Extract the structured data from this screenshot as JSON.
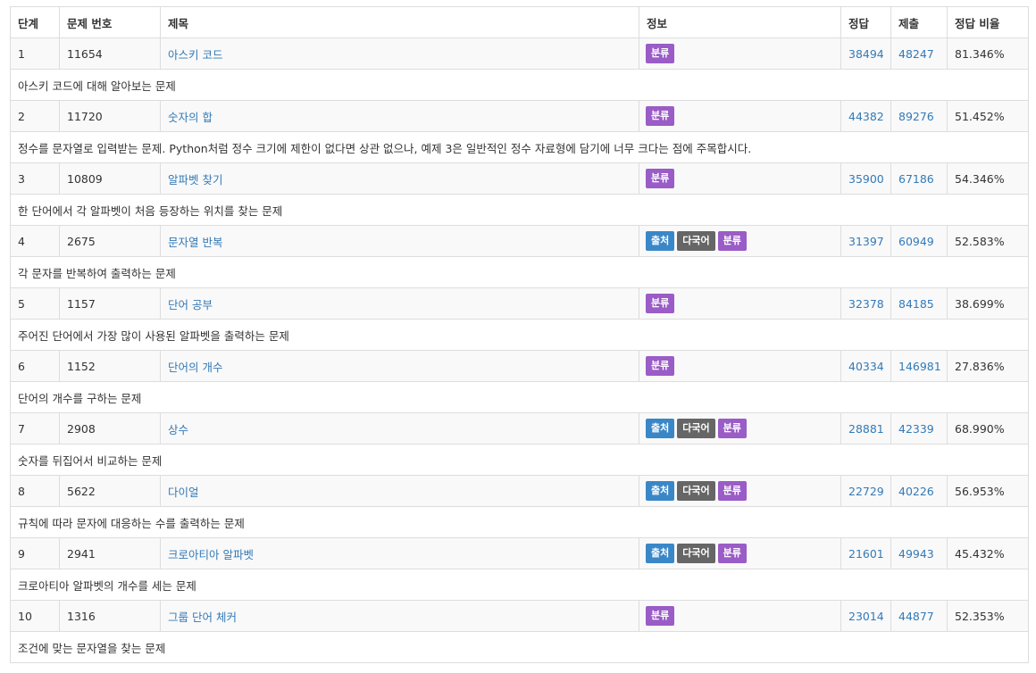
{
  "columns": {
    "level": "단계",
    "problem_id": "문제 번호",
    "title": "제목",
    "info": "정보",
    "accepted": "정답",
    "submissions": "제출",
    "ratio": "정답 비율"
  },
  "badge_labels": {
    "source": "출처",
    "multilang": "다국어",
    "category": "분류"
  },
  "badge_colors": {
    "source": "#3a87c8",
    "multilang": "#666666",
    "category": "#9a5cc6"
  },
  "link_color": "#337ab7",
  "problems": [
    {
      "level": "1",
      "id": "11654",
      "title": "아스키 코드",
      "badges": [
        "category"
      ],
      "accepted": "38494",
      "submissions": "48247",
      "ratio": "81.346%",
      "desc": "아스키 코드에 대해 알아보는 문제"
    },
    {
      "level": "2",
      "id": "11720",
      "title": "숫자의 합",
      "badges": [
        "category"
      ],
      "accepted": "44382",
      "submissions": "89276",
      "ratio": "51.452%",
      "desc": "정수를 문자열로 입력받는 문제. Python처럼 정수 크기에 제한이 없다면 상관 없으나, 예제 3은 일반적인 정수 자료형에 담기에 너무 크다는 점에 주목합시다."
    },
    {
      "level": "3",
      "id": "10809",
      "title": "알파벳 찾기",
      "badges": [
        "category"
      ],
      "accepted": "35900",
      "submissions": "67186",
      "ratio": "54.346%",
      "desc": "한 단어에서 각 알파벳이 처음 등장하는 위치를 찾는 문제"
    },
    {
      "level": "4",
      "id": "2675",
      "title": "문자열 반복",
      "badges": [
        "source",
        "multilang",
        "category"
      ],
      "accepted": "31397",
      "submissions": "60949",
      "ratio": "52.583%",
      "desc": "각 문자를 반복하여 출력하는 문제"
    },
    {
      "level": "5",
      "id": "1157",
      "title": "단어 공부",
      "badges": [
        "category"
      ],
      "accepted": "32378",
      "submissions": "84185",
      "ratio": "38.699%",
      "desc": "주어진 단어에서 가장 많이 사용된 알파벳을 출력하는 문제"
    },
    {
      "level": "6",
      "id": "1152",
      "title": "단어의 개수",
      "badges": [
        "category"
      ],
      "accepted": "40334",
      "submissions": "146981",
      "ratio": "27.836%",
      "desc": "단어의 개수를 구하는 문제"
    },
    {
      "level": "7",
      "id": "2908",
      "title": "상수",
      "badges": [
        "source",
        "multilang",
        "category"
      ],
      "accepted": "28881",
      "submissions": "42339",
      "ratio": "68.990%",
      "desc": "숫자를 뒤집어서 비교하는 문제"
    },
    {
      "level": "8",
      "id": "5622",
      "title": "다이얼",
      "badges": [
        "source",
        "multilang",
        "category"
      ],
      "accepted": "22729",
      "submissions": "40226",
      "ratio": "56.953%",
      "desc": "규칙에 따라 문자에 대응하는 수를 출력하는 문제"
    },
    {
      "level": "9",
      "id": "2941",
      "title": "크로아티아 알파벳",
      "badges": [
        "source",
        "multilang",
        "category"
      ],
      "accepted": "21601",
      "submissions": "49943",
      "ratio": "45.432%",
      "desc": "크로아티아 알파벳의 개수를 세는 문제"
    },
    {
      "level": "10",
      "id": "1316",
      "title": "그룹 단어 체커",
      "badges": [
        "category"
      ],
      "accepted": "23014",
      "submissions": "44877",
      "ratio": "52.353%",
      "desc": "조건에 맞는 문자열을 찾는 문제"
    }
  ]
}
